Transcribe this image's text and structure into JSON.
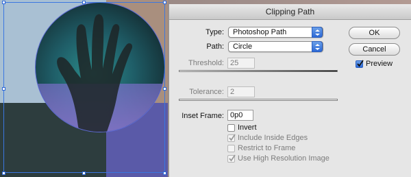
{
  "dialog": {
    "title": "Clipping Path",
    "type_label": "Type:",
    "type_value": "Photoshop Path",
    "path_label": "Path:",
    "path_value": "Circle",
    "threshold_label": "Threshold:",
    "threshold_value": "25",
    "tolerance_label": "Tolerance:",
    "tolerance_value": "2",
    "inset_label": "Inset Frame:",
    "inset_value": "0p0",
    "ok_label": "OK",
    "cancel_label": "Cancel",
    "preview_label": "Preview",
    "preview_checked": true,
    "checkboxes": [
      {
        "label": "Invert",
        "checked": false,
        "enabled": true
      },
      {
        "label": "Include Inside Edges",
        "checked": true,
        "enabled": false
      },
      {
        "label": "Restrict to Frame",
        "checked": false,
        "enabled": false
      },
      {
        "label": "Use High Resolution Image",
        "checked": true,
        "enabled": false
      }
    ]
  },
  "colors": {
    "frame_selection": "#3a77e0",
    "circle_path": "#5d6ad6",
    "accent": "#2d69d6"
  }
}
